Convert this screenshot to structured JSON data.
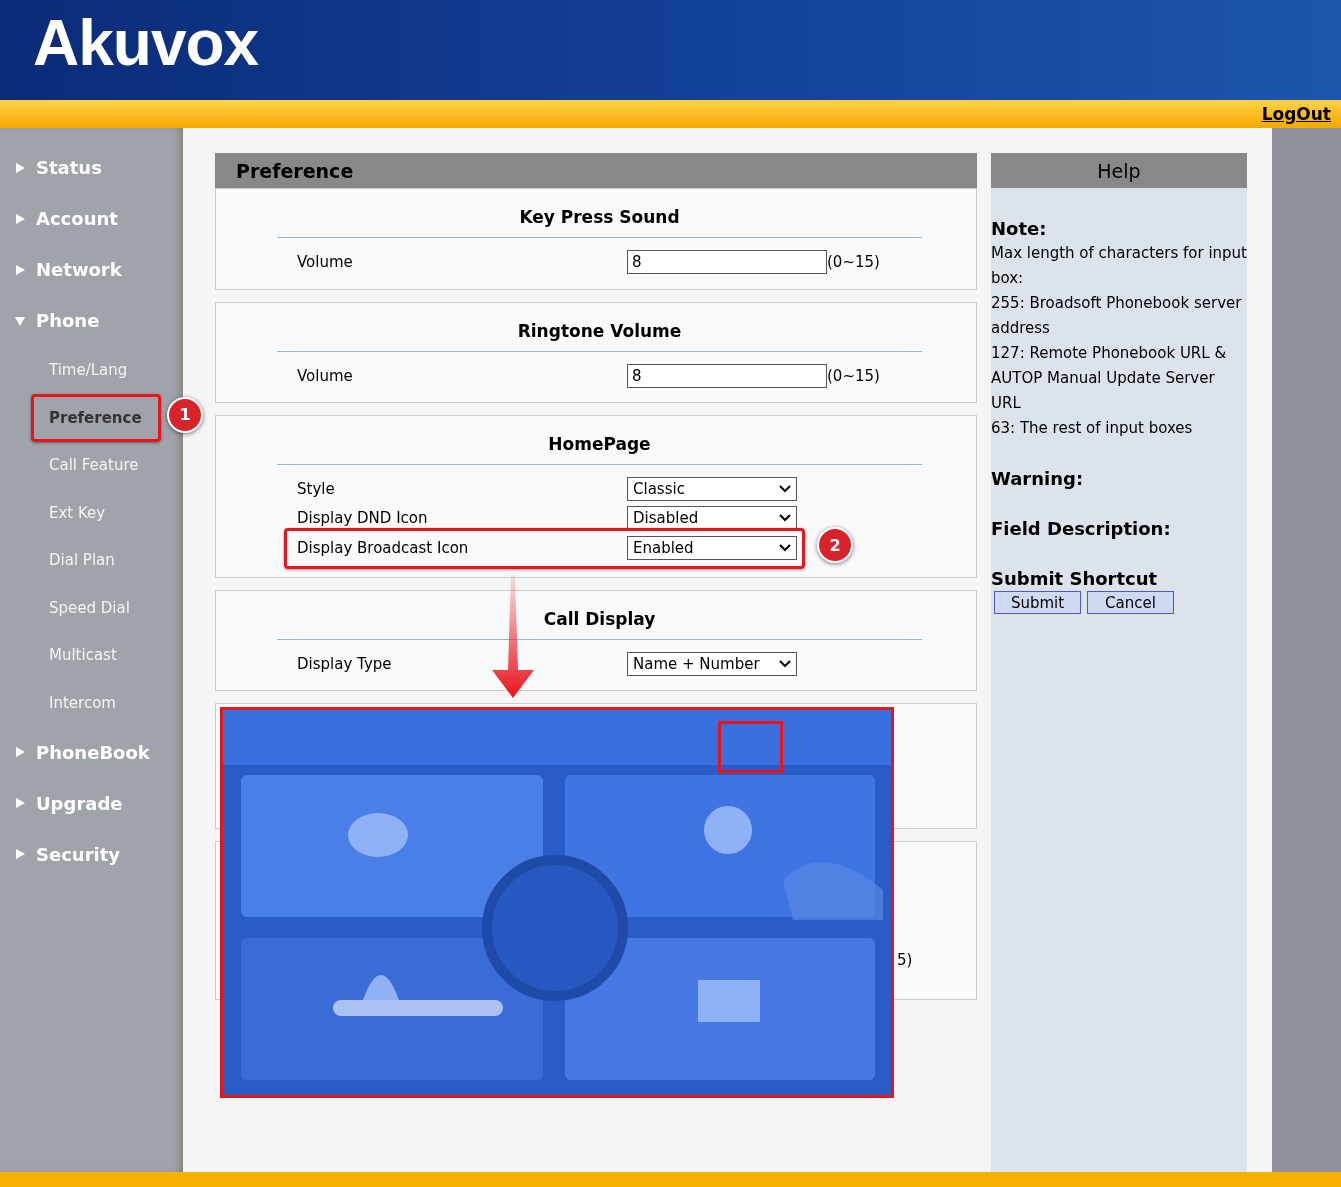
{
  "header": {
    "logo": "Akuvox",
    "logout": "LogOut"
  },
  "sidebar": {
    "items": [
      {
        "label": "Status",
        "expanded": false
      },
      {
        "label": "Account",
        "expanded": false
      },
      {
        "label": "Network",
        "expanded": false
      },
      {
        "label": "Phone",
        "expanded": true,
        "children": [
          {
            "label": "Time/Lang",
            "selected": false
          },
          {
            "label": "Preference",
            "selected": true,
            "highlighted": true
          },
          {
            "label": "Call Feature",
            "selected": false
          },
          {
            "label": "Ext Key",
            "selected": false
          },
          {
            "label": "Dial Plan",
            "selected": false
          },
          {
            "label": "Speed Dial",
            "selected": false
          },
          {
            "label": "Multicast",
            "selected": false
          },
          {
            "label": "Intercom",
            "selected": false
          }
        ]
      },
      {
        "label": "PhoneBook",
        "expanded": false
      },
      {
        "label": "Upgrade",
        "expanded": false
      },
      {
        "label": "Security",
        "expanded": false
      }
    ]
  },
  "page": {
    "title": "Preference",
    "sections": [
      {
        "heading": "Key Press Sound",
        "rows": [
          {
            "kind": "text",
            "label": "Volume",
            "value": "8",
            "hint": "(0~15)"
          }
        ]
      },
      {
        "heading": "Ringtone Volume",
        "rows": [
          {
            "kind": "text",
            "label": "Volume",
            "value": "8",
            "hint": "(0~15)"
          }
        ]
      },
      {
        "heading": "HomePage",
        "rows": [
          {
            "kind": "select",
            "label": "Style",
            "value": "Classic"
          },
          {
            "kind": "select",
            "label": "Display DND Icon",
            "value": "Disabled"
          },
          {
            "kind": "select",
            "label": "Display Broadcast Icon",
            "value": "Enabled",
            "highlighted": true
          }
        ]
      },
      {
        "heading": "Call Display",
        "rows": [
          {
            "kind": "select",
            "label": "Display Type",
            "value": "Name + Number"
          }
        ]
      }
    ],
    "obscured_text": "5)"
  },
  "help": {
    "title": "Help",
    "note_heading": "Note:",
    "note_lines": [
      "Max length of characters for input box:",
      "255: Broadsoft Phonebook server address",
      "127: Remote Phonebook URL & AUTOP Manual Update Server URL",
      "63: The rest of input boxes"
    ],
    "warning_heading": "Warning:",
    "field_heading": "Field Description:",
    "shortcut_heading": "Submit Shortcut",
    "buttons": [
      "Submit",
      "Cancel"
    ]
  },
  "annotations": {
    "markers": [
      "1",
      "2"
    ],
    "photo": {
      "kind": "picture"
    }
  }
}
